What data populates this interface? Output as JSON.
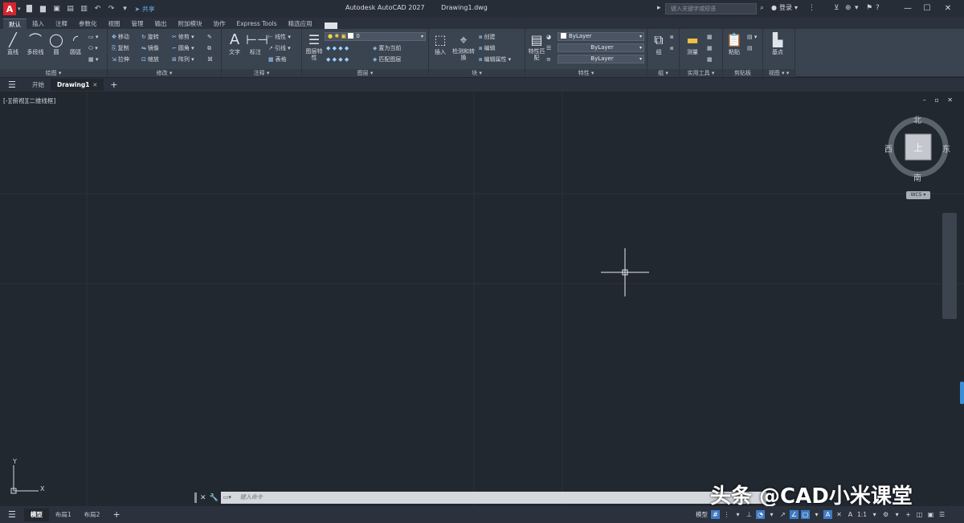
{
  "colors": {
    "canvas_bg": "#212830",
    "ribbon_bg": "#3a4350",
    "accent_blue": "#3e7bc4",
    "logo_red": "#d8242c"
  },
  "titlebar": {
    "logo_letter": "A",
    "share_label": "共享",
    "app_title": "Autodesk AutoCAD 2027",
    "file_name": "Drawing1.dwg",
    "search_placeholder": "键入关键字或短语",
    "signin_label": "登录"
  },
  "ribbon_tabs": [
    "默认",
    "插入",
    "注释",
    "参数化",
    "视图",
    "管理",
    "输出",
    "附加模块",
    "协作",
    "Express Tools",
    "精选应用"
  ],
  "panels": {
    "draw": {
      "title": "绘图",
      "line": "直线",
      "polyline": "多段线",
      "circle": "圆",
      "arc": "圆弧"
    },
    "modify": {
      "title": "修改",
      "move": "移动",
      "rotate": "旋转",
      "trim": "修剪",
      "copy": "复制",
      "mirror": "镜像",
      "fillet": "圆角",
      "stretch": "拉伸",
      "scale": "缩放",
      "array": "阵列"
    },
    "annotation": {
      "title": "注释",
      "text": "文字",
      "dimension": "标注",
      "linear": "线性",
      "leader": "引线",
      "table": "表格"
    },
    "layers": {
      "title": "图层",
      "layer_props": "图层特性",
      "current_layer": "0",
      "make_current": "置为当前",
      "match_layer": "匹配图层"
    },
    "block": {
      "title": "块",
      "insert": "插入",
      "create": "创建",
      "edit": "编辑",
      "edit_attr": "编辑属性",
      "insert_sub": "检测和转换"
    },
    "properties": {
      "title": "特性",
      "match": "特性匹配",
      "color": "ByLayer",
      "linetype": "ByLayer",
      "lineweight": "ByLayer"
    },
    "groups": {
      "title": "组",
      "group": "组"
    },
    "utilities": {
      "title": "实用工具",
      "measure": "测量"
    },
    "clipboard": {
      "title": "剪贴板",
      "paste": "粘贴"
    },
    "view": {
      "title": "视图",
      "base": "基点"
    }
  },
  "doc_tabs": {
    "start": "开始",
    "drawing": "Drawing1"
  },
  "viewport": {
    "label": "[-][俯视][二维线框]",
    "compass_north": "北",
    "compass_south": "南",
    "compass_east": "东",
    "compass_west": "西",
    "viewcube_face": "上",
    "wcs_label": "WCS"
  },
  "ucs": {
    "x_label": "X",
    "y_label": "Y"
  },
  "command_line": {
    "placeholder": "键入命令"
  },
  "watermark": "头条 @CAD小米课堂",
  "layout_tabs": [
    "模型",
    "布局1",
    "布局2"
  ],
  "statusbar": {
    "model_label": "模型",
    "scale_label": "1:1"
  }
}
